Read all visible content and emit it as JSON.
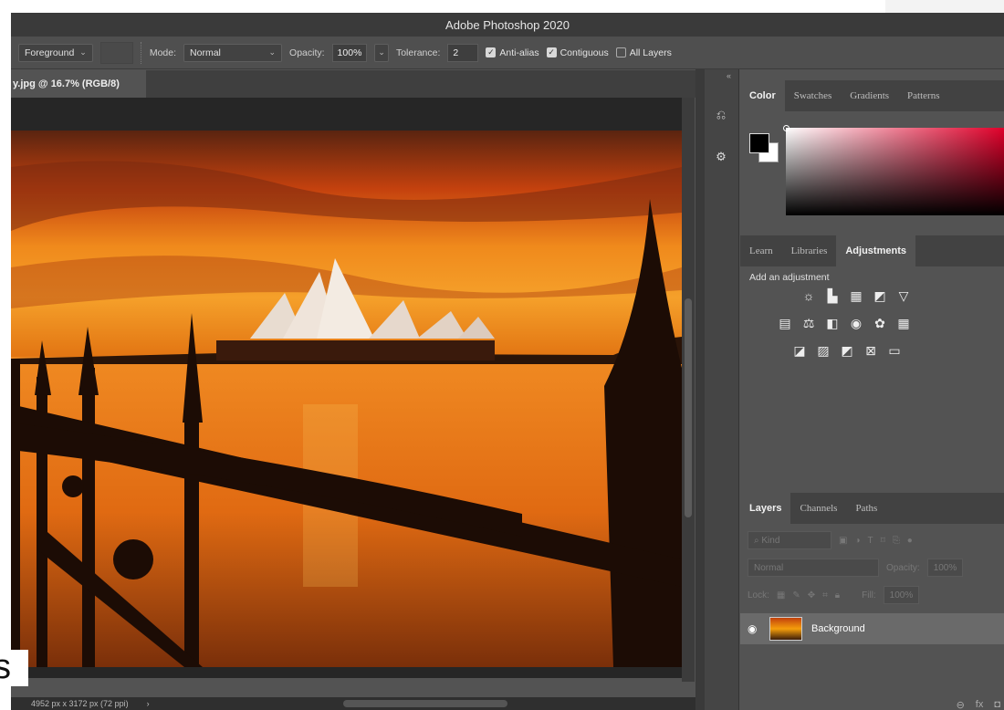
{
  "window": {
    "title": "Adobe Photoshop 2020"
  },
  "options": {
    "fill_source": "Foreground",
    "mode_label": "Mode:",
    "mode_value": "Normal",
    "opacity_label": "Opacity:",
    "opacity_value": "100%",
    "tolerance_label": "Tolerance:",
    "tolerance_value": "2",
    "antialias_label": "Anti-alias",
    "antialias_checked": true,
    "contiguous_label": "Contiguous",
    "contiguous_checked": true,
    "all_layers_label": "All Layers",
    "all_layers_checked": false
  },
  "document": {
    "tab_title": "y.jpg @ 16.7% (RGB/8)",
    "status": "4952 px x 3172 px (72 ppi)"
  },
  "color_panel": {
    "tabs": [
      "Color",
      "Swatches",
      "Gradients",
      "Patterns"
    ],
    "active": "Color"
  },
  "adjust_panel": {
    "tabs": [
      "Learn",
      "Libraries",
      "Adjustments"
    ],
    "active": "Adjustments",
    "label": "Add an adjustment"
  },
  "layers_panel": {
    "tabs": [
      "Layers",
      "Channels",
      "Paths"
    ],
    "active": "Layers",
    "kind_placeholder": "Kind",
    "blend_mode": "Normal",
    "opacity_label": "Opacity:",
    "opacity_value": "100%",
    "lock_label": "Lock:",
    "fill_label": "Fill:",
    "fill_value": "100%",
    "layers": [
      {
        "name": "Background",
        "visible": true
      }
    ]
  },
  "bottom_glyph": "s",
  "colors": {
    "accent_red": "#e0002a",
    "panel_bg": "#535353",
    "canvas_bg": "#262626"
  }
}
